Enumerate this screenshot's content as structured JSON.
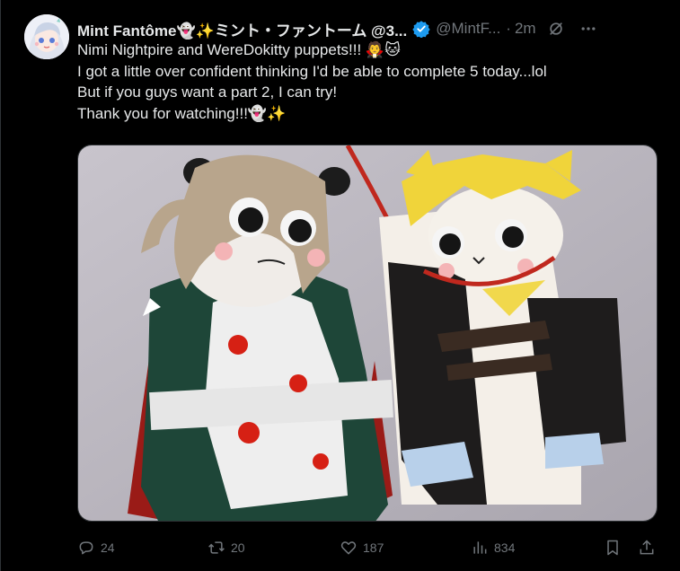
{
  "post": {
    "display_name": "Mint Fantôme👻✨ミント・ファントーム @3...",
    "handle": "@MintF...",
    "separator": "·",
    "timestamp": "2m",
    "lines": [
      "Nimi Nightpire and WereDokitty puppets!!! 🧛🐱",
      "I got a little over confident thinking I'd be able to complete 5 today...lol",
      "But if you guys want a part 2, I can try!",
      "Thank you for watching!!!👻✨"
    ]
  },
  "actions": {
    "replies": "24",
    "reposts": "20",
    "likes": "187",
    "views": "834"
  },
  "icons": {
    "verified": "verified-badge-icon",
    "grok": "grok-icon",
    "more": "more-icon",
    "reply": "reply-icon",
    "repost": "repost-icon",
    "like": "heart-icon",
    "views": "views-icon",
    "bookmark": "bookmark-icon",
    "share": "share-icon"
  },
  "colors": {
    "background": "#000000",
    "text_primary": "#e7e9ea",
    "text_secondary": "#71767b",
    "verified": "#1d9bf0"
  }
}
